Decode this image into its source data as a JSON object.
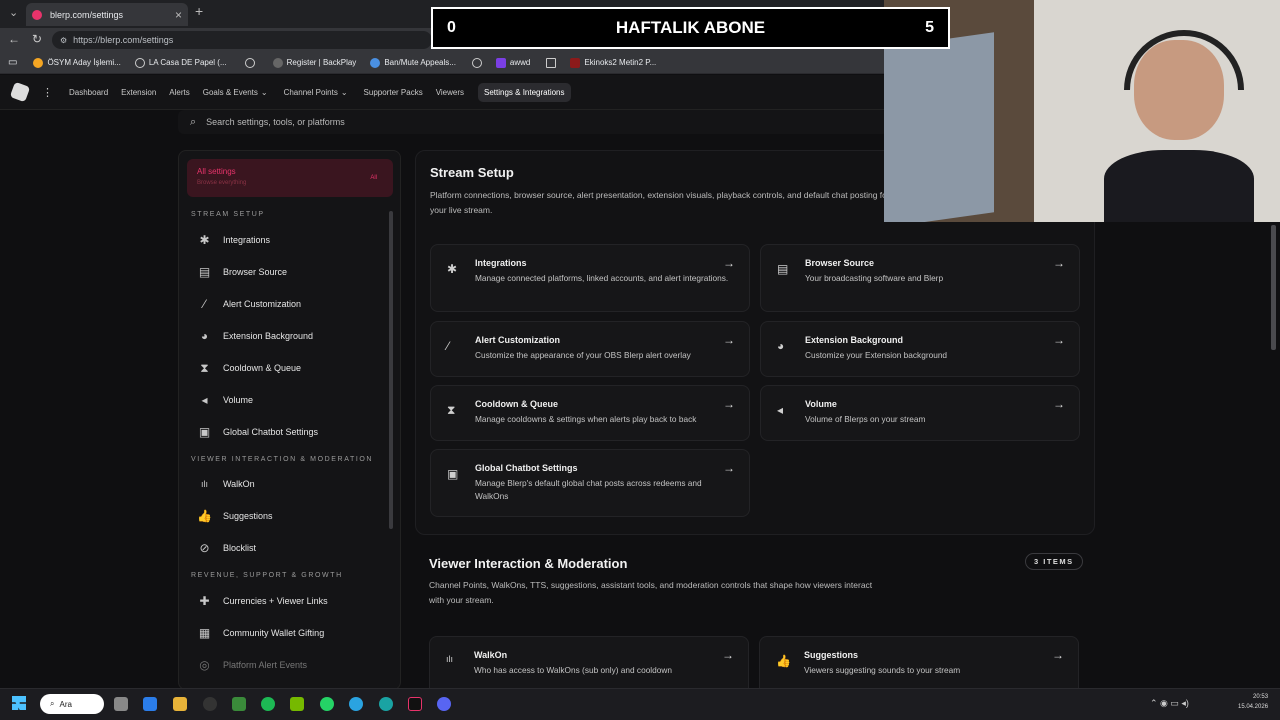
{
  "browser": {
    "tab_title": "blerp.com/settings",
    "url": "https://blerp.com/settings"
  },
  "bookmarks": [
    "ÖSYM Aday İşlemi...",
    "LA Casa DE Papel (...",
    "Register | BackPlay",
    "Ban/Mute Appeals...",
    "awwd",
    "Ekinoks2 Metin2 P..."
  ],
  "nav": {
    "items": [
      "Dashboard",
      "Extension",
      "Alerts",
      "Goals & Events",
      "Channel Points",
      "Supporter Packs",
      "Viewers",
      "Settings & Integrations"
    ]
  },
  "search": {
    "placeholder": "Search settings, tools, or platforms"
  },
  "sidebar": {
    "all_label": "All settings",
    "all_sub": "Browse everything",
    "all_tag": "All",
    "sections": [
      "STREAM SETUP",
      "VIEWER INTERACTION & MODERATION",
      "REVENUE, SUPPORT & GROWTH"
    ],
    "items": [
      "Integrations",
      "Browser Source",
      "Alert Customization",
      "Extension Background",
      "Cooldown & Queue",
      "Volume",
      "Global Chatbot Settings",
      "WalkOn",
      "Suggestions",
      "Blocklist",
      "Currencies + Viewer Links",
      "Community Wallet Gifting",
      "Platform Alert Events"
    ]
  },
  "stream_setup": {
    "title": "Stream Setup",
    "desc": "Platform connections, browser source, alert presentation, extension visuals, playback controls, and default chat posting for your live stream.",
    "cards": [
      {
        "title": "Integrations",
        "desc": "Manage connected platforms, linked accounts, and alert integrations."
      },
      {
        "title": "Browser Source",
        "desc": "Your broadcasting software and Blerp"
      },
      {
        "title": "Alert Customization",
        "desc": "Customize the appearance of your OBS Blerp alert overlay"
      },
      {
        "title": "Extension Background",
        "desc": "Customize your Extension background"
      },
      {
        "title": "Cooldown & Queue",
        "desc": "Manage cooldowns & settings when alerts play back to back"
      },
      {
        "title": "Volume",
        "desc": "Volume of Blerps on your stream"
      },
      {
        "title": "Global Chatbot Settings",
        "desc": "Manage Blerp's default global chat posts across redeems and WalkOns"
      }
    ]
  },
  "viewer_section": {
    "title": "Viewer Interaction & Moderation",
    "badge": "3 ITEMS",
    "desc": "Channel Points, WalkOns, TTS, suggestions, assistant tools, and moderation controls that shape how viewers interact with your stream.",
    "cards": [
      {
        "title": "WalkOn",
        "desc": "Who has access to WalkOns (sub only) and cooldown"
      },
      {
        "title": "Suggestions",
        "desc": "Viewers suggesting sounds to your stream"
      }
    ]
  },
  "overlay": {
    "left": "0",
    "title": "HAFTALIK ABONE",
    "right": "5"
  },
  "taskbar": {
    "search": "Ara",
    "time": "20:53",
    "date": "15.04.2026"
  }
}
